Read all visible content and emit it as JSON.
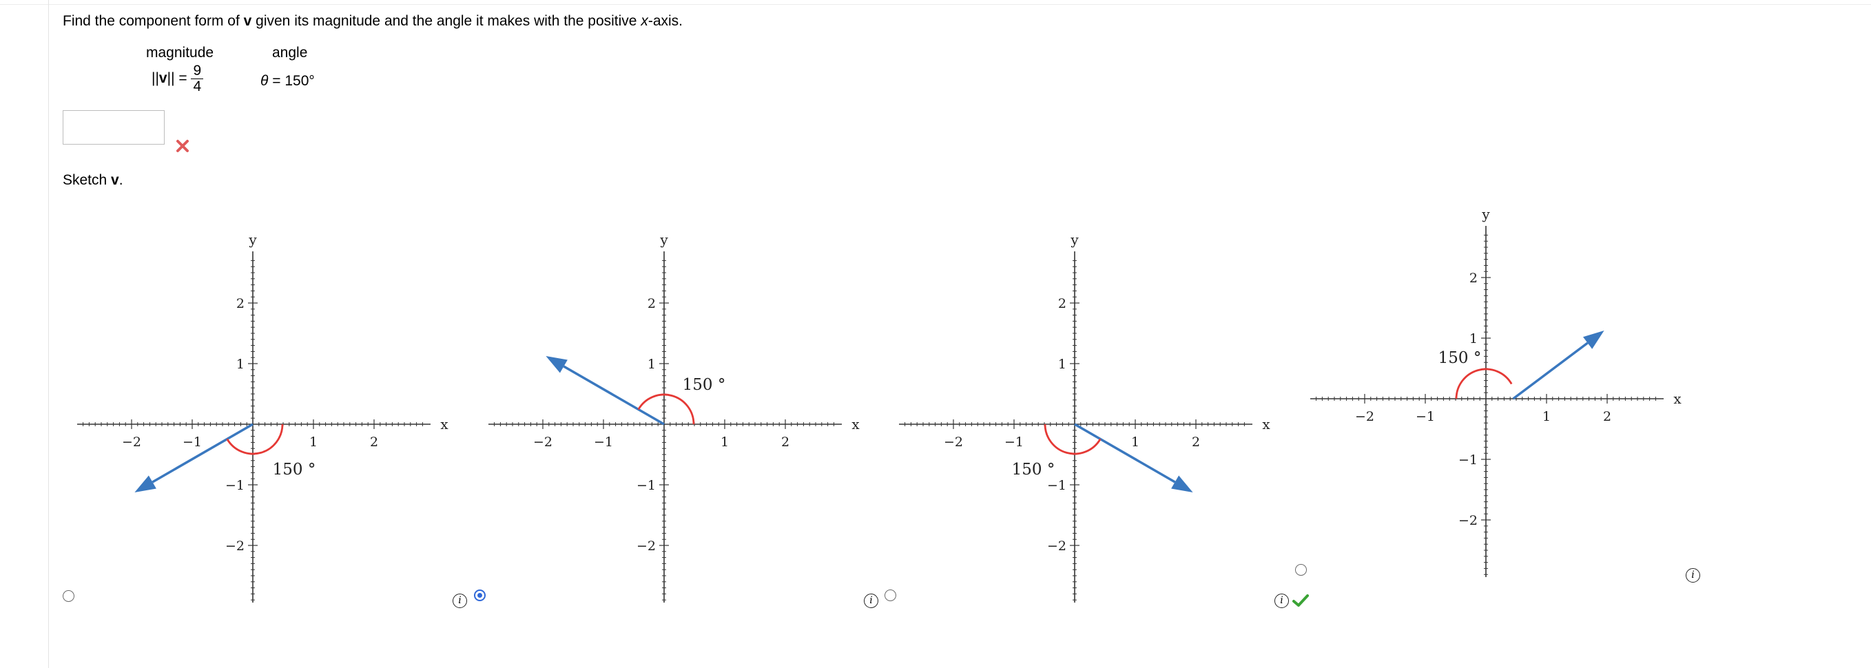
{
  "question": {
    "prefix": "Find the component form of ",
    "vector": "v",
    "middle": " given its magnitude and the angle it makes with the positive ",
    "axis_var": "x",
    "suffix": "-axis."
  },
  "givens": {
    "magnitude_label": "magnitude",
    "angle_label": "angle",
    "norm_left": "||",
    "norm_vector": "v",
    "norm_right": "|| =",
    "magnitude_numerator": "9",
    "magnitude_denominator": "4",
    "theta_symbol": "θ",
    "angle_expression": " = 150°"
  },
  "answer": {
    "value": "",
    "status": "incorrect"
  },
  "sketch": {
    "prefix": "Sketch ",
    "vector": "v",
    "suffix": "."
  },
  "colors": {
    "vector": "#3a78bf",
    "arc": "#e53935",
    "axis": "#333333",
    "wrong": "#e05a5a",
    "correct": "#3aa335",
    "radio_selected": "#2f68d8"
  },
  "options": [
    {
      "id": "A",
      "selected": false,
      "x_axis_label": "x",
      "y_axis_label": "y",
      "x_ticks": [
        "−2",
        "−1",
        "1",
        "2"
      ],
      "y_ticks": [
        "2",
        "1",
        "−1",
        "−2"
      ],
      "angle_label": "150 °",
      "vector": {
        "tail": [
          0,
          0
        ],
        "head": [
          -1.95,
          -1.125
        ]
      },
      "feedback": ""
    },
    {
      "id": "B",
      "selected": true,
      "x_axis_label": "x",
      "y_axis_label": "y",
      "x_ticks": [
        "−2",
        "−1",
        "1",
        "2"
      ],
      "y_ticks": [
        "2",
        "1",
        "−1",
        "−2"
      ],
      "angle_label": "150 °",
      "vector": {
        "tail": [
          0,
          0
        ],
        "head": [
          -1.95,
          1.125
        ]
      },
      "feedback": ""
    },
    {
      "id": "C",
      "selected": false,
      "x_axis_label": "x",
      "y_axis_label": "y",
      "x_ticks": [
        "−2",
        "−1",
        "1",
        "2"
      ],
      "y_ticks": [
        "2",
        "1",
        "−1",
        "−2"
      ],
      "angle_label": "150 °",
      "vector": {
        "tail": [
          0,
          0
        ],
        "head": [
          1.95,
          -1.125
        ]
      },
      "feedback": ""
    },
    {
      "id": "D",
      "selected": false,
      "x_axis_label": "x",
      "y_axis_label": "y",
      "x_ticks": [
        "−2",
        "−1",
        "1",
        "2"
      ],
      "y_ticks": [
        "2",
        "1",
        "−1",
        "−2"
      ],
      "angle_label": "150 °",
      "vector": {
        "tail": [
          0.45,
          0
        ],
        "head": [
          1.95,
          1.125
        ]
      },
      "feedback": "correct"
    }
  ]
}
